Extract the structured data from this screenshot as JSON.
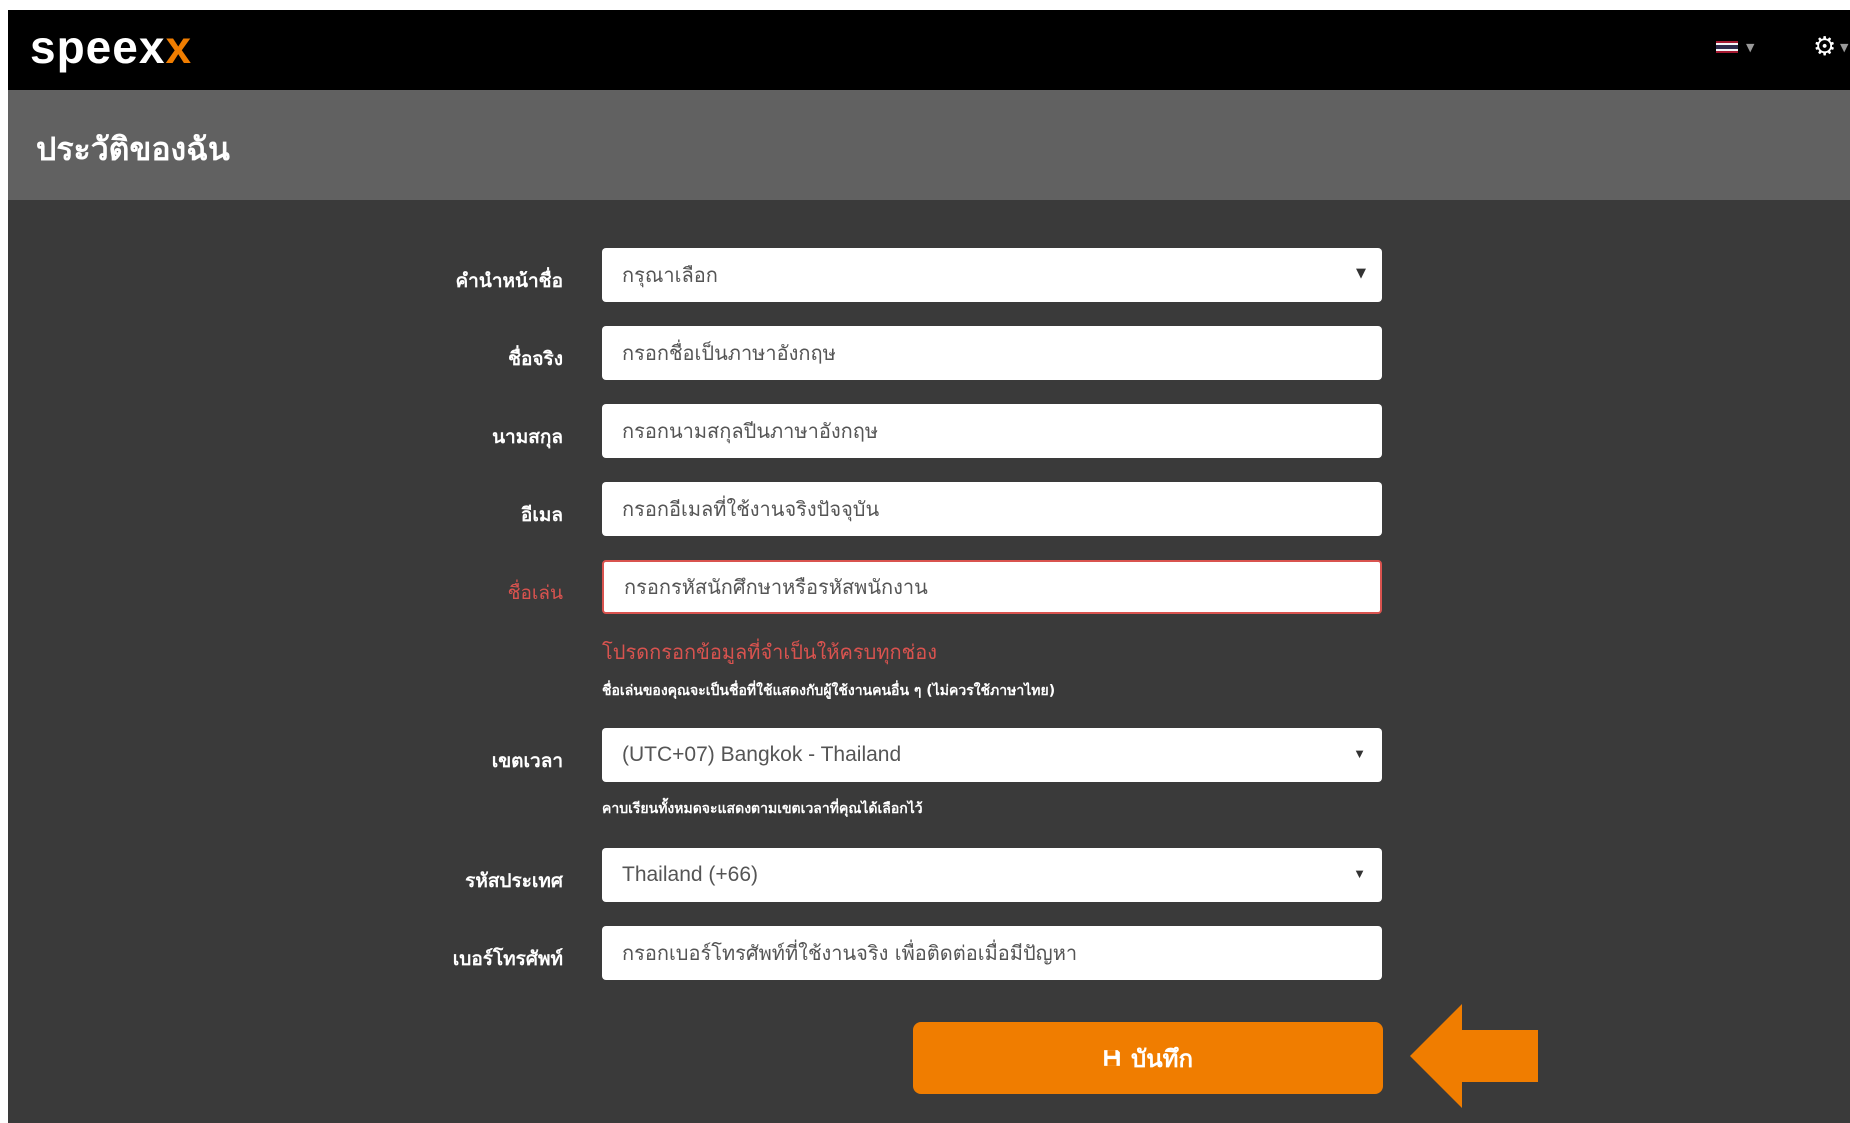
{
  "header": {
    "logo_main": "speex",
    "logo_accent": "x",
    "language_flag_colors": [
      "#A51931",
      "#F4F5F8",
      "#2D2A4A",
      "#F4F5F8",
      "#A51931"
    ],
    "language_icon": "thai-flag-icon",
    "settings_icon": "gear-icon"
  },
  "page": {
    "title": "ประวัติของฉัน"
  },
  "form": {
    "title_label": "คำนำหน้าชื่อ",
    "title_value": "กรุณาเลือก",
    "firstname_label": "ชื่อจริง",
    "firstname_placeholder": "กรอกชื่อเป็นภาษาอังกฤษ",
    "lastname_label": "นามสกุล",
    "lastname_placeholder": "กรอกนามสกุลปีนภาษาอังกฤษ",
    "email_label": "อีเมล",
    "email_placeholder": "กรอกอีเมลที่ใช้งานจริงปัจจุบัน",
    "nickname_label": "ชื่อเล่น",
    "nickname_placeholder": "กรอกรหัสนักศึกษาหรือรหัสพนักงาน",
    "required_error": "โปรดกรอกข้อมูลที่จำเป็นให้ครบทุกช่อง",
    "nickname_help": "ชื่อเล่นของคุณจะเป็นชื่อที่ใช้แสดงกับผู้ใช้งานคนอื่น ๆ (ไม่ควรใช้ภาษาไทย)",
    "timezone_label": "เขตเวลา",
    "timezone_value": "(UTC+07) Bangkok - Thailand",
    "timezone_help": "คาบเรียนทั้งหมดจะแสดงตามเขตเวลาที่คุณได้เลือกไว้",
    "country_label": "รหัสประเทศ",
    "country_value": "Thailand (+66)",
    "phone_label": "เบอร์โทรศัพท์",
    "phone_placeholder": "กรอกเบอร์โทรศัพท์ที่ใช้งานจริง เพื่อติดต่อเมื่อมีปัญหา",
    "save_label": "บันทึก",
    "save_icon": "floppy-disk-icon"
  },
  "colors": {
    "accent": "#F07D00",
    "error": "#D9534F"
  }
}
